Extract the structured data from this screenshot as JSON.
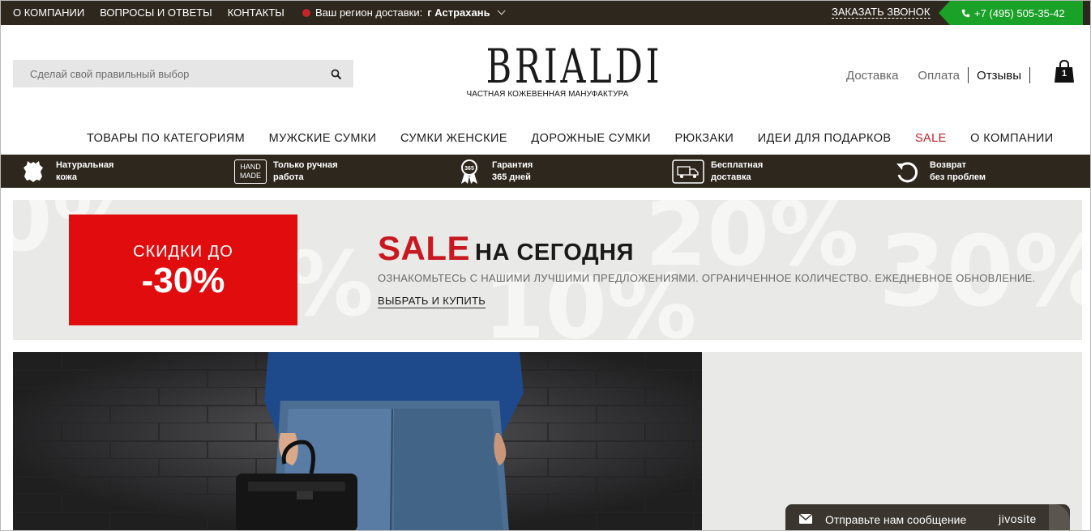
{
  "topbar": {
    "nav": [
      "О КОМПАНИИ",
      "ВОПРОСЫ И ОТВЕТЫ",
      "КОНТАКТЫ"
    ],
    "region_label": "Ваш регион доставки:",
    "region_city": "г Астрахань",
    "callback": "ЗАКАЗАТЬ ЗВОНОК",
    "phone": "+7 (495) 505-35-42"
  },
  "search": {
    "placeholder": "Сделай свой правильный выбор"
  },
  "logo": {
    "name": "BRIALDI",
    "tagline": "ЧАСТНАЯ КОЖЕВЕННАЯ МАНУФАКТУРА"
  },
  "header_links": [
    "Доставка",
    "Оплата",
    "Отзывы"
  ],
  "cart": {
    "count": "1"
  },
  "main_nav": [
    "ТОВАРЫ ПО КАТЕГОРИЯМ",
    "МУЖСКИЕ СУМКИ",
    "СУМКИ ЖЕНСКИЕ",
    "ДОРОЖНЫЕ СУМКИ",
    "РЮКЗАКИ",
    "ИДЕИ ДЛЯ ПОДАРКОВ",
    "SALE",
    "О КОМПАНИИ"
  ],
  "features": [
    {
      "icon": "leather-hide-icon",
      "line1": "Натуральная",
      "line2": "кожа"
    },
    {
      "icon": "handmade-badge-icon",
      "badge1": "HAND",
      "badge2": "MADE",
      "line1": "Только ручная",
      "line2": "работа"
    },
    {
      "icon": "warranty-365-icon",
      "badge": "365",
      "line1": "Гарантия",
      "line2": "365 дней"
    },
    {
      "icon": "delivery-truck-icon",
      "line1": "Бесплатная",
      "line2": "доставка"
    },
    {
      "icon": "return-arrow-icon",
      "line1": "Возврат",
      "line2": "без проблем"
    }
  ],
  "banner": {
    "discount_label": "СКИДКИ ДО",
    "discount_value": "-30%",
    "title_sale": "SALE",
    "title_rest": "НА СЕГОДНЯ",
    "description": "ОЗНАКОМЬТЕСЬ С НАШИМИ ЛУЧШИМИ ПРЕДЛОЖЕНИЯМИ. ОГРАНИЧЕННОЕ КОЛИЧЕСТВО. ЕЖЕДНЕВНОЕ ОБНОВЛЕНИЕ.",
    "cta": "ВЫБРАТЬ И КУПИТЬ",
    "bg_numbers": [
      "0%",
      "%",
      "20%",
      "30%",
      "10%"
    ]
  },
  "chat": {
    "label": "Отправьте нам сообщение",
    "brand": "jivosite"
  },
  "colors": {
    "dark_bar": "#2e271d",
    "phone_green": "#1aa128",
    "sale_red": "#c91920",
    "promo_red": "#e10c0e",
    "banner_gray": "#e9e9e7"
  }
}
